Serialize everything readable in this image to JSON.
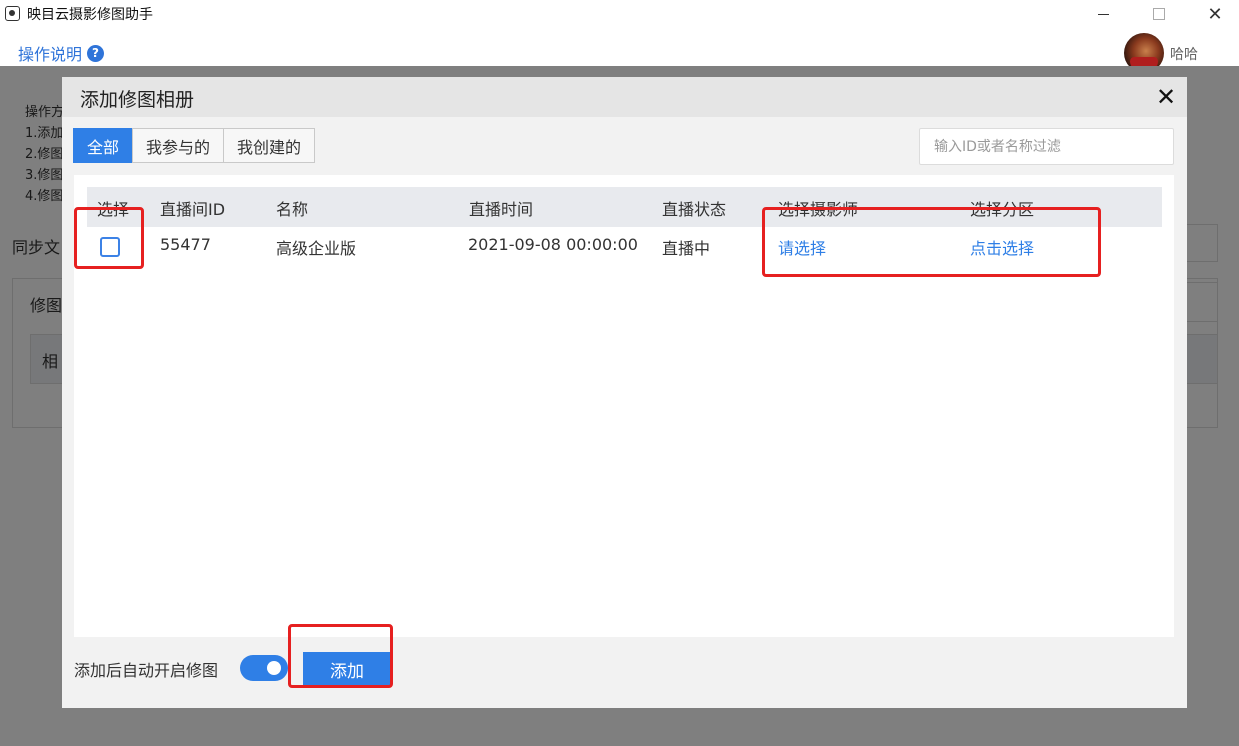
{
  "window": {
    "title": "映目云摄影修图助手",
    "close_glyph": "✕"
  },
  "header": {
    "help_label": "操作说明",
    "help_icon": "?",
    "username": "哈哈"
  },
  "background": {
    "line1": "操作方",
    "line2": "1.添加",
    "line3": "2.修图",
    "line4": "3.修图",
    "line5": "4.修图",
    "sync_label": "同步文",
    "retouch_label": "修图",
    "album_label": "相"
  },
  "modal": {
    "title": "添加修图相册",
    "close_glyph": "✕",
    "tabs": [
      {
        "label": "全部",
        "active": true
      },
      {
        "label": "我参与的",
        "active": false
      },
      {
        "label": "我创建的",
        "active": false
      }
    ],
    "filter_placeholder": "输入ID或者名称过滤",
    "columns": [
      "选择",
      "直播间ID",
      "名称",
      "直播时间",
      "直播状态",
      "选择摄影师",
      "选择分区"
    ],
    "rows": [
      {
        "checked": false,
        "id": "55477",
        "name": "高级企业版",
        "time": "2021-09-08 00:00:00",
        "status": "直播中",
        "photographer": "请选择",
        "partition": "点击选择"
      }
    ],
    "auto_start_label": "添加后自动开启修图",
    "auto_start_enabled": true,
    "add_button": "添加"
  },
  "colors": {
    "accent": "#2f7fe6",
    "highlight": "#e62020"
  }
}
